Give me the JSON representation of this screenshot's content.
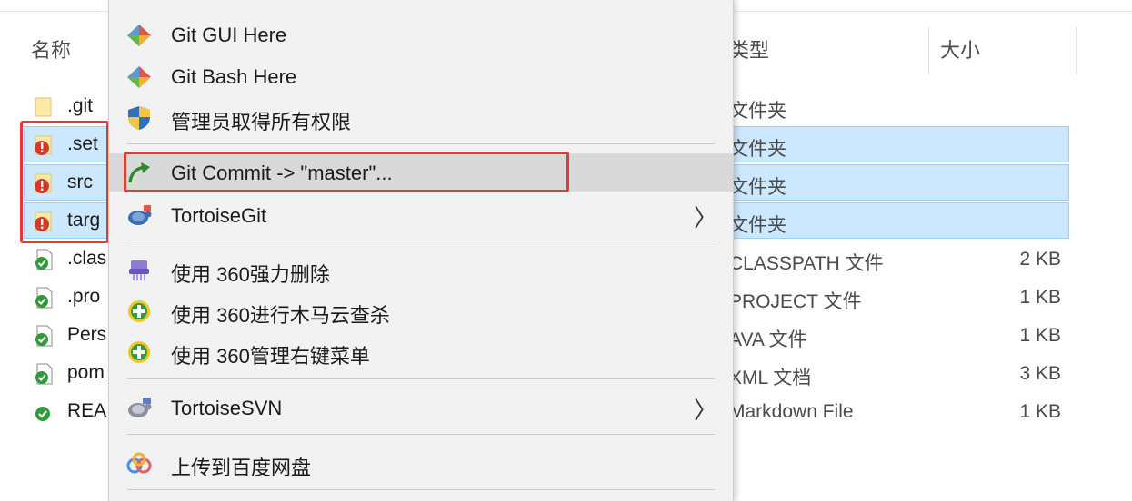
{
  "explorer": {
    "columns": {
      "name": "名称",
      "type": "类型",
      "size": "大小"
    },
    "files": [
      {
        "name": ".git",
        "type": "文件夹",
        "size": "",
        "status": "none",
        "selected": false
      },
      {
        "name": ".set",
        "type": "文件夹",
        "size": "",
        "status": "modified",
        "selected": true
      },
      {
        "name": "src",
        "type": "文件夹",
        "size": "",
        "status": "modified",
        "selected": true
      },
      {
        "name": "targ",
        "type": "文件夹",
        "size": "",
        "status": "modified",
        "selected": true
      },
      {
        "name": ".clas",
        "type": "CLASSPATH 文件",
        "size": "2 KB",
        "status": "normal",
        "selected": false
      },
      {
        "name": ".pro",
        "type": "PROJECT 文件",
        "size": "1 KB",
        "status": "normal",
        "selected": false
      },
      {
        "name": "Pers",
        "type": "AVA 文件",
        "size": "1 KB",
        "status": "normal",
        "selected": false
      },
      {
        "name": "pom",
        "type": "XML 文档",
        "size": "3 KB",
        "status": "normal",
        "selected": false
      },
      {
        "name": "REA",
        "type": "Markdown File",
        "size": "1 KB",
        "status": "normal",
        "selected": false
      }
    ]
  },
  "context_menu": {
    "items": [
      {
        "label": "Git GUI Here",
        "icon": "git-diamond-icon"
      },
      {
        "label": "Git Bash Here",
        "icon": "git-diamond-icon"
      },
      {
        "label": "管理员取得所有权限",
        "icon": "uac-shield-icon"
      },
      {
        "label": "Git Commit -> \"master\"...",
        "icon": "git-commit-arrow-icon",
        "highlighted": true
      },
      {
        "label": "TortoiseGit",
        "icon": "tortoisegit-icon",
        "submenu": true
      },
      {
        "label": "使用 360强力删除",
        "icon": "360-shredder-icon"
      },
      {
        "label": "使用 360进行木马云查杀",
        "icon": "360-shield-icon"
      },
      {
        "label": "使用 360管理右键菜单",
        "icon": "360-shield-icon"
      },
      {
        "label": "TortoiseSVN",
        "icon": "tortoisesvn-icon",
        "submenu": true
      },
      {
        "label": "上传到百度网盘",
        "icon": "baidu-netdisk-icon"
      }
    ],
    "submenu_glyph": "〉"
  },
  "colors": {
    "selection_bg": "#cce8ff",
    "annotation_red": "#e53935",
    "menu_bg": "#f2f2f2",
    "menu_highlight": "#d9d9d9"
  }
}
